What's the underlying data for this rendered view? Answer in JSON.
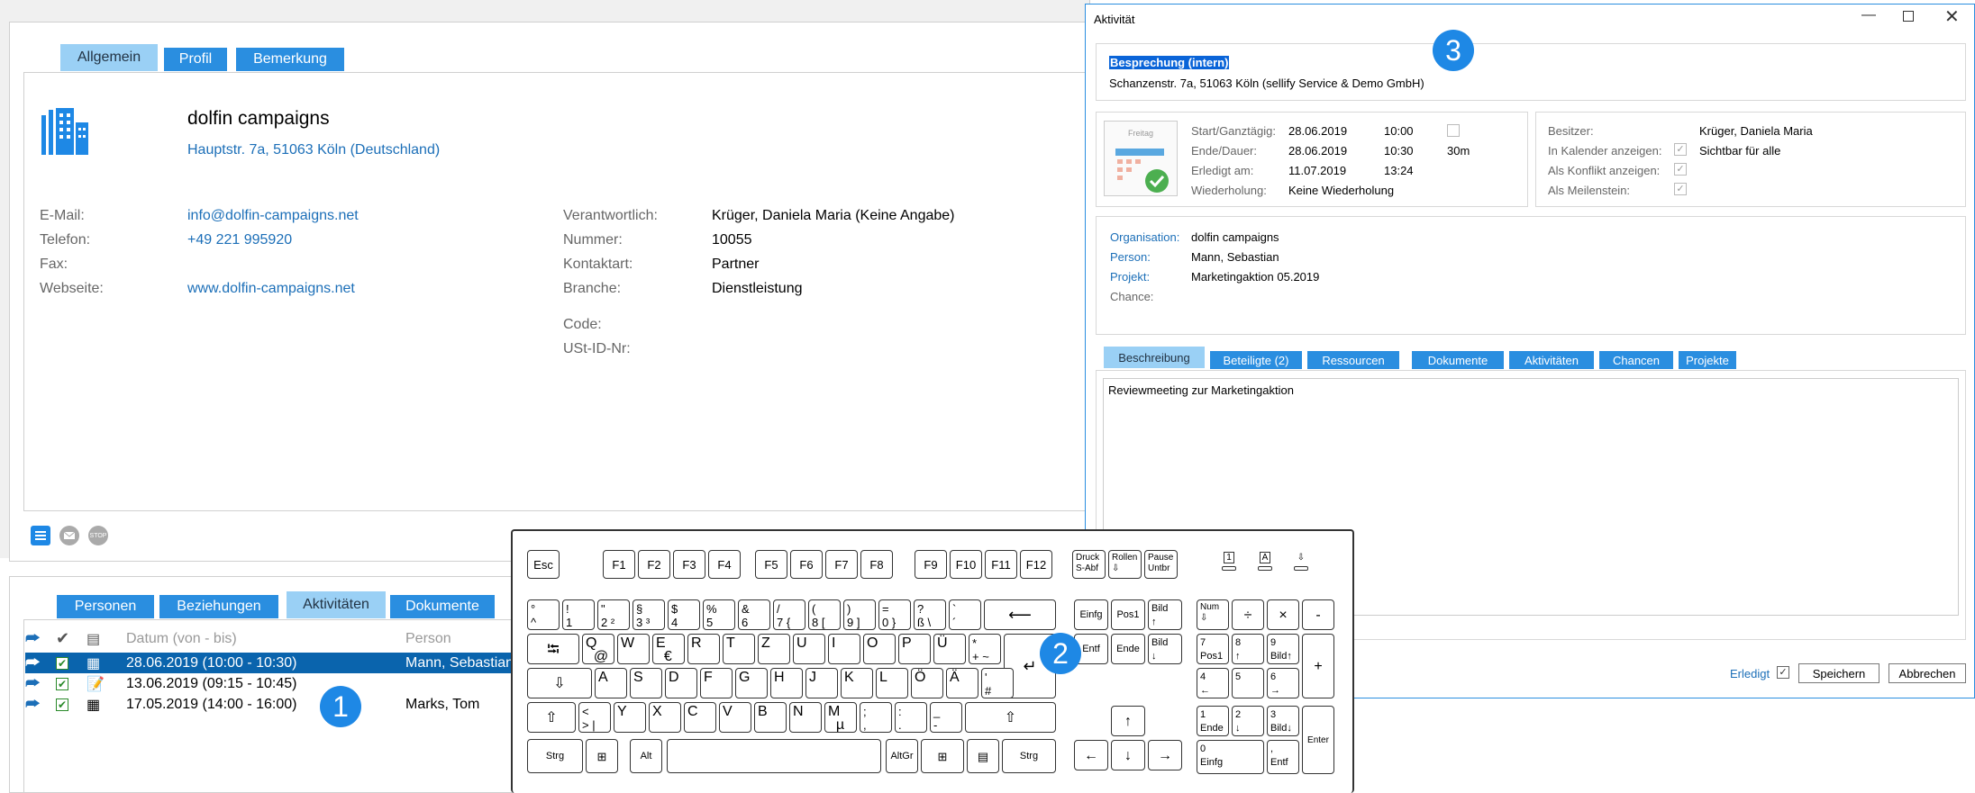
{
  "contact": {
    "tabs": [
      "Allgemein",
      "Profil",
      "Bemerkung"
    ],
    "name": "dolfin campaigns",
    "address": "Hauptstr. 7a, 51063 Köln (Deutschland)",
    "left_fields": [
      {
        "label": "E-Mail:",
        "value": "info@dolfin-campaigns.net"
      },
      {
        "label": "Telefon:",
        "value": "+49 221 995920"
      },
      {
        "label": "Fax:",
        "value": ""
      },
      {
        "label": "Webseite:",
        "value": "www.dolfin-campaigns.net"
      }
    ],
    "right_fields": [
      {
        "label": "Verantwortlich:",
        "value": "Krüger, Daniela Maria (Keine Angabe)"
      },
      {
        "label": "Nummer:",
        "value": "10055"
      },
      {
        "label": "Kontaktart:",
        "value": "Partner"
      },
      {
        "label": "Branche:",
        "value": "Dienstleistung"
      }
    ],
    "extra_fields": [
      {
        "label": "Code:",
        "value": ""
      },
      {
        "label": "USt-ID-Nr:",
        "value": ""
      }
    ]
  },
  "lower": {
    "tabs": [
      "Personen",
      "Beziehungen",
      "Aktivitäten",
      "Dokumente"
    ],
    "columns": {
      "date": "Datum (von - bis)",
      "person": "Person"
    },
    "rows": [
      {
        "date": "28.06.2019 (10:00 - 10:30)",
        "person": "Mann, Sebastian"
      },
      {
        "date": "13.06.2019 (09:15 - 10:45)",
        "person": ""
      },
      {
        "date": "17.05.2019 (14:00 - 16:00)",
        "person": "Marks, Tom"
      }
    ]
  },
  "markers": [
    "1",
    "2",
    "3"
  ],
  "dialog": {
    "title": "Aktivität",
    "subject": "Besprechung (intern)",
    "location": "Schanzenstr. 7a, 51063 Köln (sellify Service & Demo GmbH)",
    "calendar_caption": "Freitag",
    "times": {
      "start_label": "Start/Ganztägig:",
      "start_date": "28.06.2019",
      "start_time": "10:00",
      "end_label": "Ende/Dauer:",
      "end_date": "28.06.2019",
      "end_time": "10:30",
      "duration": "30m",
      "done_label": "Erledigt am:",
      "done_date": "11.07.2019",
      "done_time": "13:24",
      "repeat_label": "Wiederholung:",
      "repeat_value": "Keine Wiederholung"
    },
    "owner": {
      "owner_label": "Besitzer:",
      "owner_value": "Krüger, Daniela Maria",
      "calendar_label": "In Kalender anzeigen:",
      "calendar_value": "Sichtbar für alle",
      "conflict_label": "Als Konflikt anzeigen:",
      "milestone_label": "Als Meilenstein:"
    },
    "refs": [
      {
        "label": "Organisation:",
        "value": "dolfin campaigns"
      },
      {
        "label": "Person:",
        "value": "Mann, Sebastian"
      },
      {
        "label": "Projekt:",
        "value": "Marketingaktion 05.2019"
      },
      {
        "label": "Chance:",
        "value": ""
      }
    ],
    "tabs": [
      "Beschreibung",
      "Beteiligte (2)",
      "Ressourcen",
      "Dokumente",
      "Aktivitäten",
      "Chancen",
      "Projekte"
    ],
    "description": "Reviewmeeting zur Marketingaktion",
    "erledigt_label": "Erledigt",
    "save_label": "Speichern",
    "cancel_label": "Abbrechen"
  },
  "keyboard": {
    "fn_row": [
      "Esc",
      "F1",
      "F2",
      "F3",
      "F4",
      "F5",
      "F6",
      "F7",
      "F8",
      "F9",
      "F10",
      "F11",
      "F12",
      "Druck\nS-Abf",
      "Rollen\n⇩",
      "Pause\nUntbr"
    ],
    "row1": [
      "°\n^",
      "!\n1",
      "\"\n2 ²",
      "§\n3 ³",
      "$\n4",
      "%\n5",
      "&\n6",
      "/\n7 {",
      "(\n8 [",
      ")\n9 ]",
      "=\n0 }",
      "?\nß \\",
      "`\n´",
      "⟵"
    ],
    "row2": [
      "⭾",
      "Q\n  @",
      "W",
      "E\n  €",
      "R",
      "T",
      "Z",
      "U",
      "I",
      "O",
      "P",
      "Ü",
      "*\n+ ~",
      "↵"
    ],
    "row3": [
      "⇩",
      "A",
      "S",
      "D",
      "F",
      "G",
      "H",
      "J",
      "K",
      "L",
      "Ö",
      "Ä",
      "'\n#"
    ],
    "row4": [
      "⇧",
      "<\n> |",
      "Y",
      "X",
      "C",
      "V",
      "B",
      "N",
      "M\n  µ",
      ";\n,",
      ":\n.",
      "_\n-",
      "⇧"
    ],
    "row5": [
      "Strg",
      "⊞",
      "Alt",
      "",
      "AltGr",
      "⊞",
      "▤",
      "Strg"
    ],
    "nav1": [
      "Einfg",
      "Pos1",
      "Bild\n↑"
    ],
    "nav2": [
      "Entf",
      "Ende",
      "Bild\n↓"
    ],
    "arrows": [
      "↑",
      "←",
      "↓",
      "→"
    ],
    "num": [
      "Num\n⇩",
      "÷",
      "×",
      "-",
      "7\nPos1",
      "8\n↑",
      "9\nBild↑",
      "+",
      "4\n←",
      "5",
      "6\n→",
      "1\nEnde",
      "2\n↓",
      "3\nBild↓",
      "Enter",
      "0\nEinfg",
      ",\nEntf"
    ],
    "leds": [
      "1",
      "A",
      "⇩"
    ]
  }
}
